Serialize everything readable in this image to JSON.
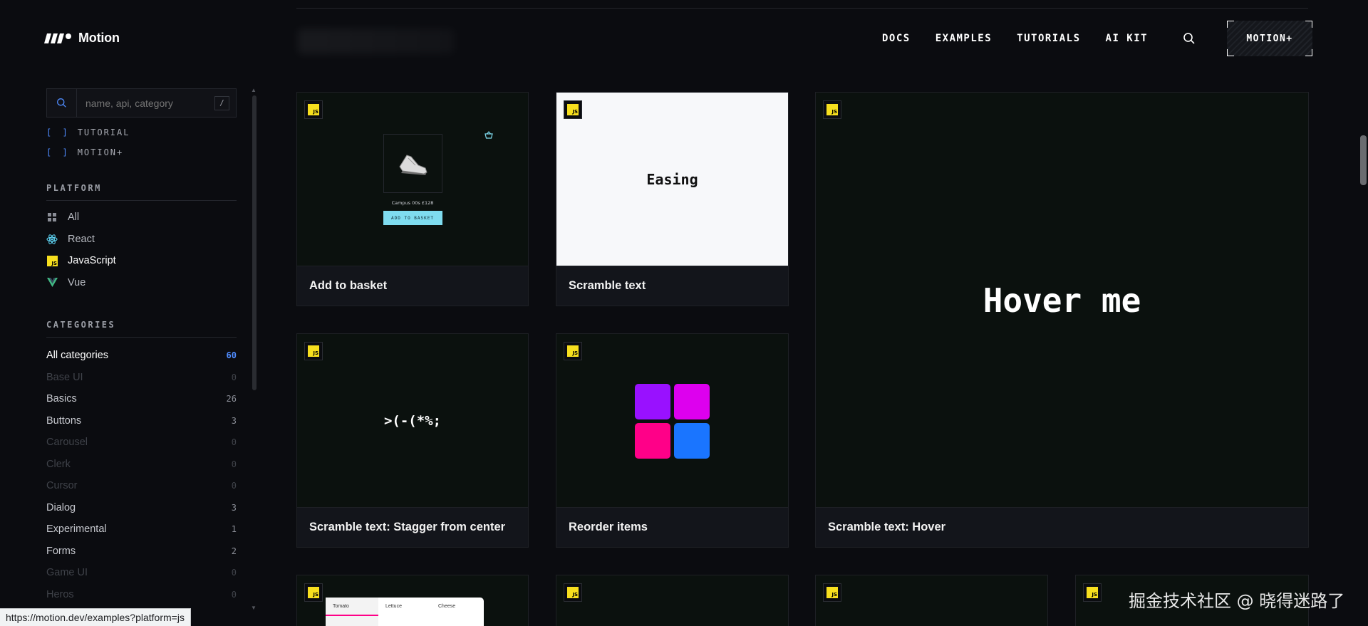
{
  "header": {
    "logo_text": "Motion",
    "nav": [
      "DOCS",
      "EXAMPLES",
      "TUTORIALS",
      "AI KIT"
    ],
    "motion_plus": "MOTION+"
  },
  "sidebar": {
    "search": {
      "placeholder": "name, api, category",
      "shortcut": "/"
    },
    "links": [
      {
        "bracket": "[ ]",
        "label": "TUTORIAL"
      },
      {
        "bracket": "[ ]",
        "label": "MOTION+"
      }
    ],
    "platform_title": "PLATFORM",
    "platforms": [
      {
        "label": "All",
        "icon": "grid-icon"
      },
      {
        "label": "React",
        "icon": "react-icon"
      },
      {
        "label": "JavaScript",
        "icon": "javascript-icon",
        "active": true
      },
      {
        "label": "Vue",
        "icon": "vue-icon"
      }
    ],
    "categories_title": "CATEGORIES",
    "categories": [
      {
        "label": "All categories",
        "count": "60",
        "active": true
      },
      {
        "label": "Base UI",
        "count": "0"
      },
      {
        "label": "Basics",
        "count": "26"
      },
      {
        "label": "Buttons",
        "count": "3"
      },
      {
        "label": "Carousel",
        "count": "0"
      },
      {
        "label": "Clerk",
        "count": "0"
      },
      {
        "label": "Cursor",
        "count": "0"
      },
      {
        "label": "Dialog",
        "count": "3"
      },
      {
        "label": "Experimental",
        "count": "1"
      },
      {
        "label": "Forms",
        "count": "2"
      },
      {
        "label": "Game UI",
        "count": "0"
      },
      {
        "label": "Heros",
        "count": "0"
      }
    ]
  },
  "cards": {
    "badge": "JS",
    "add_to_basket": {
      "title": "Add to basket",
      "product": "Campus 00s  £128",
      "button": "ADD TO BASKET"
    },
    "scramble_text": {
      "title": "Scramble text",
      "preview": "Easing"
    },
    "scramble_hover": {
      "title": "Scramble text: Hover",
      "preview": "Hover me"
    },
    "scramble_center": {
      "title": "Scramble text: Stagger from center",
      "preview": ">(-(*%;"
    },
    "reorder": {
      "title": "Reorder items",
      "colors": [
        "#9911ff",
        "#dd00ee",
        "#ff0088",
        "#1a75ff"
      ]
    },
    "tabs": [
      "Tomato",
      "Lettuce",
      "Cheese"
    ]
  },
  "status_url": "https://motion.dev/examples?platform=js",
  "watermark": "掘金技术社区 @ 晓得迷路了"
}
